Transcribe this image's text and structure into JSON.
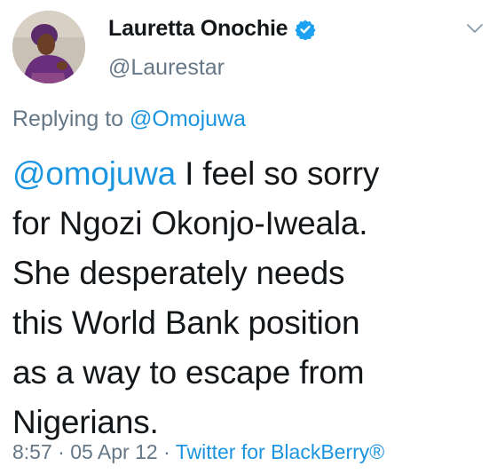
{
  "user": {
    "display_name": "Lauretta Onochie",
    "handle": "@Laurestar",
    "verified": true,
    "avatar_icon": "profile-photo",
    "verified_color": "#1da1f2"
  },
  "menu": {
    "icon": "chevron-down-icon"
  },
  "reply": {
    "prefix": "Replying to ",
    "mention": "@Omojuwa"
  },
  "tweet": {
    "mention": "@omojuwa",
    "lines": [
      " I feel so sorry",
      "for Ngozi Okonjo-Iweala.",
      "She desperately needs",
      "this World Bank position",
      "as a way to escape from",
      "Nigerians."
    ]
  },
  "meta": {
    "time": "8:57",
    "sep1": " · ",
    "date": "05 Apr 12",
    "sep2": " · ",
    "source": "Twitter for BlackBerry®"
  },
  "colors": {
    "link": "#1b95e0",
    "secondary": "#657786",
    "text": "#14171a"
  }
}
